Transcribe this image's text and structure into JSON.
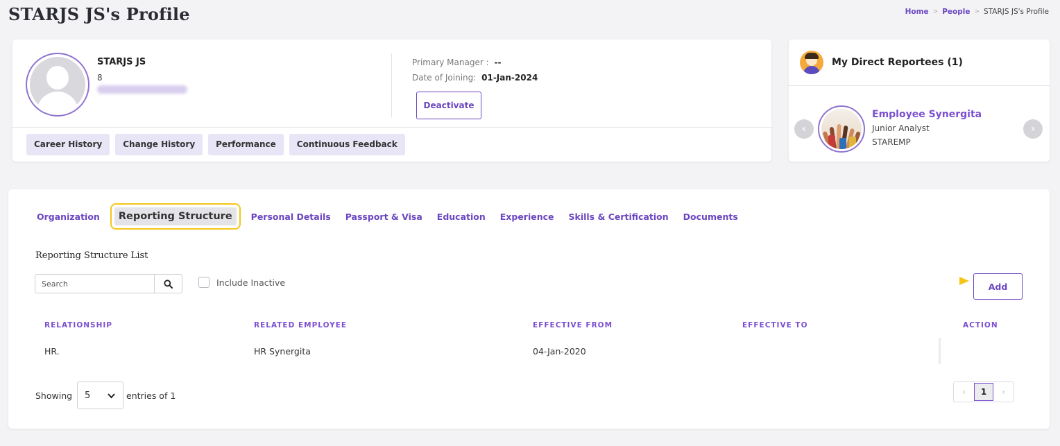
{
  "page": {
    "title": "STARJS JS's Profile",
    "breadcrumb": [
      "Home",
      "People",
      "STARJS JS's Profile"
    ]
  },
  "profile": {
    "name": "STARJS JS",
    "employee_id": "8",
    "primary_manager_label": "Primary Manager :",
    "primary_manager_value": "--",
    "doj_label": "Date of Joining:",
    "doj_value": "01-Jan-2024",
    "deactivate_label": "Deactivate",
    "pills": [
      "Career History",
      "Change History",
      "Performance",
      "Continuous Feedback"
    ]
  },
  "reportees": {
    "title": "My Direct Reportees (1)",
    "items": [
      {
        "name": "Employee Synergita",
        "role": "Junior Analyst",
        "dept": "STAREMP"
      }
    ]
  },
  "tabs": {
    "items": [
      "Organization",
      "Reporting Structure",
      "Personal Details",
      "Passport & Visa",
      "Education",
      "Experience",
      "Skills & Certification",
      "Documents"
    ],
    "active": "Reporting Structure"
  },
  "list": {
    "title": "Reporting Structure List",
    "search_placeholder": "Search",
    "include_inactive_label": "Include Inactive",
    "add_label": "Add",
    "columns": [
      "RELATIONSHIP",
      "RELATED EMPLOYEE",
      "EFFECTIVE FROM",
      "EFFECTIVE TO",
      "ACTION"
    ],
    "rows": [
      {
        "relationship": "HR.",
        "related_employee": "HR Synergita",
        "effective_from": "04-Jan-2020",
        "effective_to": ""
      }
    ],
    "showing_label": "Showing",
    "page_size": "5",
    "entries_label": "entries of 1",
    "current_page": "1"
  },
  "colors": {
    "accent": "#6b46c1",
    "highlight": "#f5c518"
  }
}
